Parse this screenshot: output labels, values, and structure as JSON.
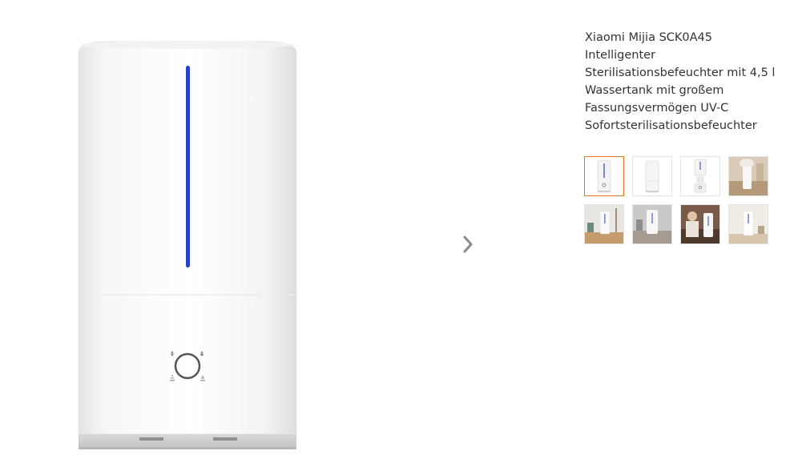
{
  "product": {
    "title": "Xiaomi Mijia SCK0A45 Intelligenter Sterilisationsbefeuchter mit 4,5 l Wassertank mit großem Fassungsvermögen UV-C Sofortsterilisationsbefeuchter"
  },
  "gallery": {
    "main_image": "humidifier-front",
    "next_icon": "chevron-right-icon",
    "selected_index": 0,
    "thumbnails": [
      {
        "subject": "humidifier-front"
      },
      {
        "subject": "humidifier-side"
      },
      {
        "subject": "humidifier-exploded"
      },
      {
        "subject": "humidifier-mist-room"
      },
      {
        "subject": "humidifier-on-table"
      },
      {
        "subject": "humidifier-grey-scene"
      },
      {
        "subject": "humidifier-with-person"
      },
      {
        "subject": "humidifier-on-shelf"
      }
    ]
  },
  "colors": {
    "accent_selected_border": "#e8731f",
    "water_level_indicator": "#2a3fc2",
    "chevron": "#8a8a8a",
    "title_text": "#333333"
  }
}
